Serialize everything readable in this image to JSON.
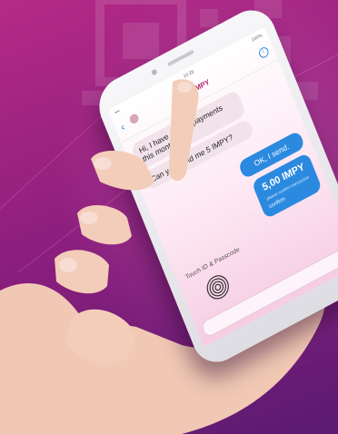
{
  "chat": {
    "status_time": "10:26",
    "status_battery": "100%",
    "brand": "IMPY",
    "brand_mark": "IM",
    "messages": [
      {
        "text": "Hi, I have a lot of payments this month.",
        "side": "in"
      },
      {
        "text": "Can you send me 5 IMPY?",
        "side": "in"
      },
      {
        "text": "OK, I send.",
        "side": "out"
      }
    ],
    "payment": {
      "amount": "5,00 IMPY",
      "caption": "please confirm transaction",
      "confirm_label": "confirm"
    },
    "touch_id_label": "Touch ID & Passcode"
  },
  "icons": [
    "back-icon",
    "info-icon",
    "fingerprint-icon",
    "plus-icon"
  ],
  "colors": {
    "background": "#9b2384",
    "accent": "#2b8ae0",
    "brand": "#b0246f"
  }
}
